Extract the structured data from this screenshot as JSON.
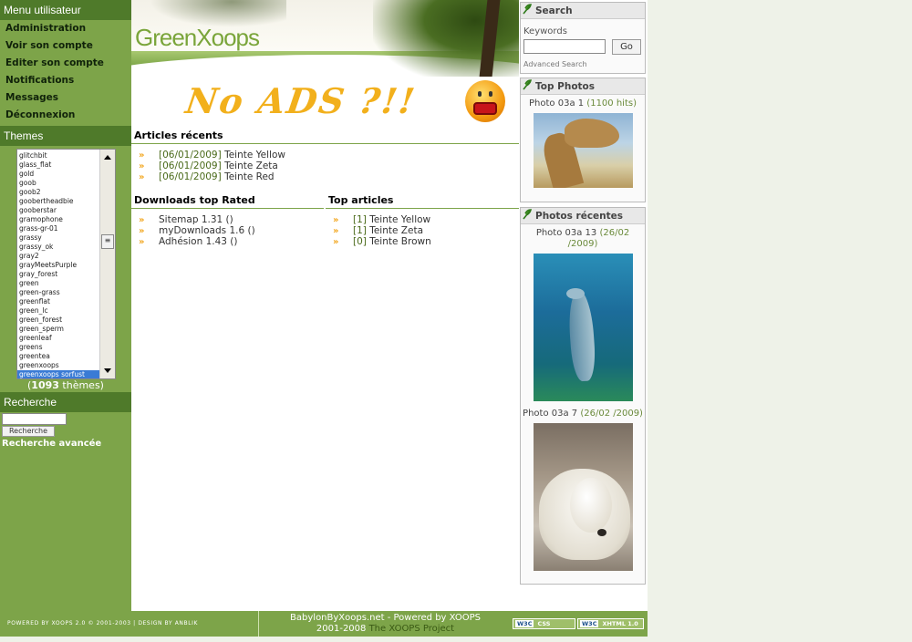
{
  "user_menu": {
    "title": "Menu utilisateur",
    "items": [
      "Administration",
      "Voir son compte",
      "Editer son compte",
      "Notifications",
      "Messages",
      "Déconnexion"
    ]
  },
  "themes": {
    "title": "Themes",
    "list": [
      "glitchbit",
      "glass_flat",
      "gold",
      "goob",
      "goob2",
      "goobertheadbie",
      "gooberstar",
      "gramophone",
      "grass-gr-01",
      "grassy",
      "grassy_ok",
      "gray2",
      "grayMeetsPurple",
      "gray_forest",
      "green",
      "green-grass",
      "greenflat",
      "green_lc",
      "green_forest",
      "green_sperm",
      "greenleaf",
      "greens",
      "greentea",
      "greenxoops",
      "greenxoops sorfust"
    ],
    "selected": "greenxoops sorfust",
    "count_prefix": "(",
    "count": "1093",
    "count_suffix": " thèmes)"
  },
  "left_search": {
    "title": "Recherche",
    "button": "Recherche",
    "advanced": "Recherche avancée"
  },
  "banner": {
    "logo": "GreenXoops",
    "ad_text": "No ADS ?!!"
  },
  "recent_articles": {
    "title": "Articles récents",
    "items": [
      {
        "date": "[06/01/2009]",
        "title": "Teinte Yellow"
      },
      {
        "date": "[06/01/2009]",
        "title": "Teinte Zeta"
      },
      {
        "date": "[06/01/2009]",
        "title": "Teinte Red"
      }
    ]
  },
  "downloads": {
    "title": "Downloads top Rated",
    "items": [
      "Sitemap 1.31 ()",
      "myDownloads 1.6 ()",
      "Adhésion 1.43 ()"
    ]
  },
  "top_articles": {
    "title": "Top articles",
    "items": [
      {
        "rank": "[1]",
        "title": "Teinte Yellow"
      },
      {
        "rank": "[1]",
        "title": "Teinte Zeta"
      },
      {
        "rank": "[0]",
        "title": "Teinte Brown"
      }
    ]
  },
  "right_search": {
    "title": "Search",
    "keywords_label": "Keywords",
    "go": "Go",
    "advanced": "Advanced Search"
  },
  "top_photos": {
    "title": "Top Photos",
    "items": [
      {
        "name": "Photo 03a 1",
        "meta": " (1100 hits)"
      }
    ]
  },
  "recent_photos": {
    "title": "Photos récentes",
    "items": [
      {
        "name": "Photo 03a 13",
        "meta": " (26/02 /2009)"
      },
      {
        "name": "Photo 03a 7",
        "meta": " (26/02 /2009)"
      }
    ]
  },
  "footer": {
    "left": "POWERED BY XOOPS 2.0 © 2001-2003   |   DESIGN BY ANBLIK",
    "center_line1": "BabylonByXoops.net - Powered by XOOPS",
    "center_line2": "2001-2008 ",
    "center_link": "The XOOPS Project",
    "badge_w3c": "W3C",
    "badge_css": "CSS",
    "badge_xhtml": "XHTML 1.0"
  },
  "colors": {
    "sidebar": "#7da449",
    "sidebar_header": "#4f7a2a",
    "accent_orange": "#f2a51c",
    "link_green": "#4a6a1a"
  }
}
